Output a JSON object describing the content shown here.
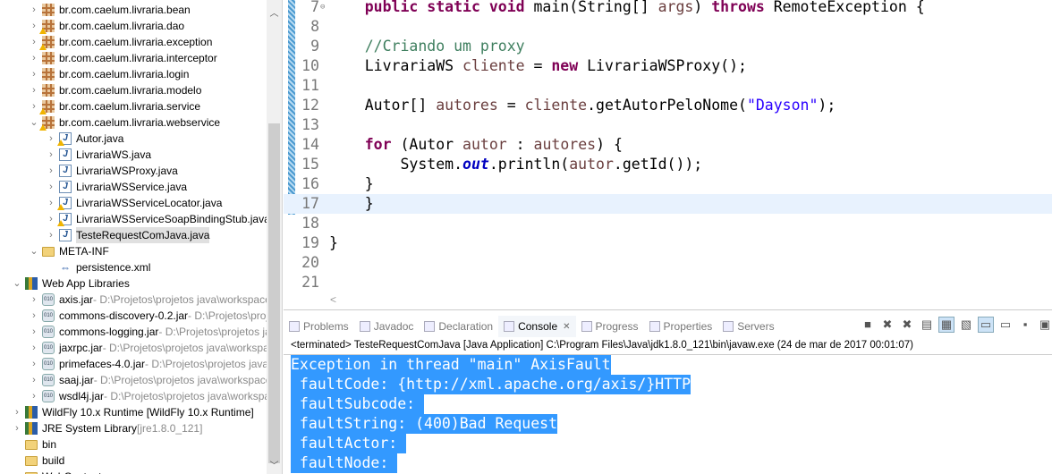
{
  "explorer": {
    "rows": [
      {
        "label": "br.com.caelum.livraria.bean",
        "icon": "package",
        "twisty": "collapsed",
        "indent": 1,
        "warn": false
      },
      {
        "label": "br.com.caelum.livraria.dao",
        "icon": "package",
        "twisty": "collapsed",
        "indent": 1,
        "warn": true
      },
      {
        "label": "br.com.caelum.livraria.exception",
        "icon": "package",
        "twisty": "collapsed",
        "indent": 1,
        "warn": true
      },
      {
        "label": "br.com.caelum.livraria.interceptor",
        "icon": "package",
        "twisty": "collapsed",
        "indent": 1,
        "warn": false
      },
      {
        "label": "br.com.caelum.livraria.login",
        "icon": "package",
        "twisty": "collapsed",
        "indent": 1,
        "warn": false
      },
      {
        "label": "br.com.caelum.livraria.modelo",
        "icon": "package",
        "twisty": "collapsed",
        "indent": 1,
        "warn": false
      },
      {
        "label": "br.com.caelum.livraria.service",
        "icon": "package",
        "twisty": "collapsed",
        "indent": 1,
        "warn": true
      },
      {
        "label": "br.com.caelum.livraria.webservice",
        "icon": "package",
        "twisty": "expanded",
        "indent": 1,
        "warn": true
      },
      {
        "label": "Autor.java",
        "icon": "java",
        "twisty": "collapsed",
        "indent": 2,
        "warn": true
      },
      {
        "label": "LivrariaWS.java",
        "icon": "java-interface",
        "twisty": "collapsed",
        "indent": 2,
        "warn": false
      },
      {
        "label": "LivrariaWSProxy.java",
        "icon": "java",
        "twisty": "collapsed",
        "indent": 2,
        "warn": false
      },
      {
        "label": "LivrariaWSService.java",
        "icon": "java-interface",
        "twisty": "collapsed",
        "indent": 2,
        "warn": false
      },
      {
        "label": "LivrariaWSServiceLocator.java",
        "icon": "java",
        "twisty": "collapsed",
        "indent": 2,
        "warn": true
      },
      {
        "label": "LivrariaWSServiceSoapBindingStub.java",
        "icon": "java",
        "twisty": "collapsed",
        "indent": 2,
        "warn": true
      },
      {
        "label": "TesteRequestComJava.java",
        "icon": "java",
        "twisty": "collapsed",
        "indent": 2,
        "warn": false,
        "selected": true
      },
      {
        "label": "META-INF",
        "icon": "folder",
        "twisty": "expanded",
        "indent": 1,
        "warn": false
      },
      {
        "label": "persistence.xml",
        "icon": "xml",
        "twisty": "none",
        "indent": 2,
        "warn": false
      },
      {
        "label": "Web App Libraries",
        "icon": "library",
        "twisty": "expanded",
        "indent": 0,
        "warn": false
      },
      {
        "label": "axis.jar",
        "path": " - D:\\Projetos\\projetos java\\workspaceA",
        "icon": "jar",
        "twisty": "collapsed",
        "indent": 1
      },
      {
        "label": "commons-discovery-0.2.jar",
        "path": " - D:\\Projetos\\proje",
        "icon": "jar",
        "twisty": "collapsed",
        "indent": 1
      },
      {
        "label": "commons-logging.jar",
        "path": " - D:\\Projetos\\projetos ja",
        "icon": "jar",
        "twisty": "collapsed",
        "indent": 1
      },
      {
        "label": "jaxrpc.jar",
        "path": " - D:\\Projetos\\projetos java\\workspac",
        "icon": "jar",
        "twisty": "collapsed",
        "indent": 1
      },
      {
        "label": "primefaces-4.0.jar",
        "path": " - D:\\Projetos\\projetos java\\w",
        "icon": "jar",
        "twisty": "collapsed",
        "indent": 1
      },
      {
        "label": "saaj.jar",
        "path": " - D:\\Projetos\\projetos java\\workspaceA",
        "icon": "jar",
        "twisty": "collapsed",
        "indent": 1
      },
      {
        "label": "wsdl4j.jar",
        "path": " - D:\\Projetos\\projetos java\\workspac",
        "icon": "jar",
        "twisty": "collapsed",
        "indent": 1
      },
      {
        "label": "WildFly 10.x Runtime [WildFly 10.x Runtime]",
        "icon": "library",
        "twisty": "collapsed",
        "indent": 0
      },
      {
        "label": "JRE System Library",
        "path": " [jre1.8.0_121]",
        "icon": "library",
        "twisty": "collapsed",
        "indent": 0
      },
      {
        "label": "bin",
        "icon": "folder",
        "twisty": "none",
        "indent": 0
      },
      {
        "label": "build",
        "icon": "folder",
        "twisty": "none",
        "indent": 0
      },
      {
        "label": "WebContent",
        "icon": "folder",
        "twisty": "none",
        "indent": 0
      }
    ]
  },
  "editor": {
    "current_line": "17",
    "lines": [
      {
        "n": "7",
        "t": [
          [
            "    ",
            ""
          ],
          [
            "public static void",
            "kw"
          ],
          [
            " main(String[] ",
            ""
          ],
          [
            "args",
            "vr"
          ],
          [
            ") ",
            ""
          ],
          [
            "throws",
            "kw"
          ],
          [
            " RemoteException {",
            ""
          ]
        ]
      },
      {
        "n": "8",
        "t": []
      },
      {
        "n": "9",
        "t": [
          [
            "    ",
            ""
          ],
          [
            "//",
            "cm"
          ],
          [
            "Criando",
            "cm sq"
          ],
          [
            " ",
            "cm"
          ],
          [
            "um",
            "cm sq"
          ],
          [
            " ",
            "cm"
          ],
          [
            "proxy",
            "cm sq"
          ]
        ]
      },
      {
        "n": "10",
        "t": [
          [
            "    LivrariaWS ",
            ""
          ],
          [
            "cliente",
            "vr"
          ],
          [
            " = ",
            ""
          ],
          [
            "new",
            "kw"
          ],
          [
            " LivrariaWSProxy();",
            ""
          ]
        ]
      },
      {
        "n": "11",
        "t": []
      },
      {
        "n": "12",
        "t": [
          [
            "    Autor[] ",
            ""
          ],
          [
            "autores",
            "vr"
          ],
          [
            " = ",
            ""
          ],
          [
            "cliente",
            "vr"
          ],
          [
            ".getAutorPeloNome(",
            ""
          ],
          [
            "\"Dayson\"",
            "st"
          ],
          [
            ");",
            ""
          ]
        ]
      },
      {
        "n": "13",
        "t": []
      },
      {
        "n": "14",
        "t": [
          [
            "    ",
            ""
          ],
          [
            "for",
            "kw"
          ],
          [
            " (Autor ",
            ""
          ],
          [
            "autor",
            "vr"
          ],
          [
            " : ",
            ""
          ],
          [
            "autores",
            "vr"
          ],
          [
            ") {",
            ""
          ]
        ]
      },
      {
        "n": "15",
        "t": [
          [
            "        System.",
            ""
          ],
          [
            "out",
            "fd"
          ],
          [
            ".println(",
            ""
          ],
          [
            "autor",
            "vr"
          ],
          [
            ".getId());",
            ""
          ]
        ]
      },
      {
        "n": "16",
        "t": [
          [
            "    }",
            ""
          ]
        ]
      },
      {
        "n": "17",
        "t": [
          [
            "    }",
            ""
          ]
        ]
      },
      {
        "n": "18",
        "t": []
      },
      {
        "n": "19",
        "t": [
          [
            "}",
            ""
          ]
        ]
      },
      {
        "n": "20",
        "t": []
      },
      {
        "n": "21",
        "t": []
      }
    ]
  },
  "console": {
    "tabs": [
      {
        "label": "Problems",
        "active": false
      },
      {
        "label": "Javadoc",
        "active": false
      },
      {
        "label": "Declaration",
        "active": false
      },
      {
        "label": "Console",
        "active": true
      },
      {
        "label": "Progress",
        "active": false
      },
      {
        "label": "Properties",
        "active": false
      },
      {
        "label": "Servers",
        "active": false
      }
    ],
    "close_glyph": "✕",
    "status": "<terminated> TesteRequestComJava [Java Application] C:\\Program Files\\Java\\jdk1.8.0_121\\bin\\javaw.exe (24 de mar de 2017 00:01:07)",
    "output": [
      "Exception in thread \"main\" AxisFault",
      " faultCode: {http://xml.apache.org/axis/}HTTP",
      " faultSubcode: ",
      " faultString: (400)Bad Request",
      " faultActor: ",
      " faultNode: "
    ],
    "toolbar": [
      "terminate-icon",
      "remove-launch-icon",
      "remove-all-icon",
      "clear-console-icon",
      "scroll-lock-icon",
      "word-wrap-icon",
      "show-on-stdout-icon",
      "show-on-stderr-icon",
      "pin-console-icon",
      "display-console-icon"
    ]
  },
  "colors": {
    "selection": "#3399ff",
    "current_line": "#e8f2fe",
    "keyword": "#7f0055"
  }
}
